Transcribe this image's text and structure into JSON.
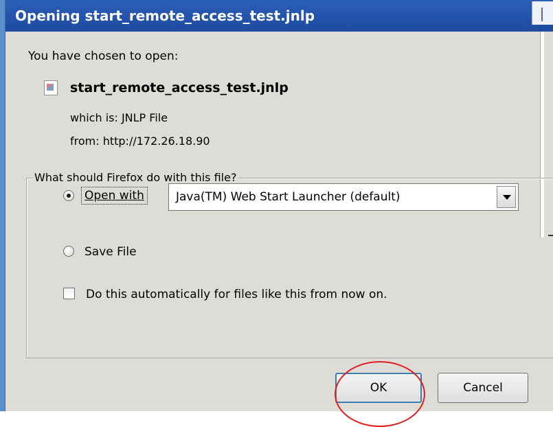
{
  "dialog": {
    "title": "Opening start_remote_access_test.jnlp",
    "intro": "You have chosen to open:",
    "filename": "start_remote_access_test.jnlp",
    "which_is": "which is:  JNLP File",
    "from": "from:  http://172.26.18.90"
  },
  "action_group": {
    "legend": "What should Firefox do with this file?",
    "open_with_label": "Open with",
    "open_with_selected": true,
    "open_with_app": "Java(TM) Web Start Launcher (default)",
    "save_file_label": "Save File",
    "save_file_selected": false,
    "auto_label": "Do this automatically for files like this from now on.",
    "auto_checked": false
  },
  "buttons": {
    "ok": "OK",
    "cancel": "Cancel"
  },
  "colors": {
    "titlebar": "#2b5fb8",
    "dialog_bg": "#dedcd7",
    "highlight_circle": "#e01e1e"
  },
  "icons": {
    "file": "jnlp-file-icon",
    "dropdown": "chevron-down-icon"
  }
}
